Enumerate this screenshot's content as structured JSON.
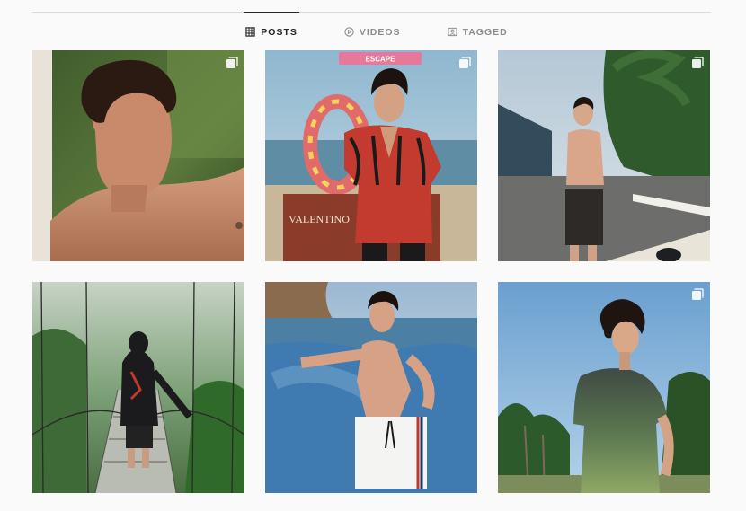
{
  "tabs": [
    {
      "label": "POSTS",
      "icon": "grid-icon",
      "active": true
    },
    {
      "label": "VIDEOS",
      "icon": "play-circle-icon",
      "active": false
    },
    {
      "label": "TAGGED",
      "icon": "tag-portrait-icon",
      "active": false
    }
  ],
  "posts": [
    {
      "icon": "carousel-icon",
      "desc": "close-up portrait, curly hair, green foliage"
    },
    {
      "icon": "carousel-icon",
      "desc": "patterned shirt on beach with float ring",
      "sign_text": "ESCAPE",
      "box_text": "VALENTINO"
    },
    {
      "icon": "carousel-icon",
      "desc": "standing on pavement, palm trees"
    },
    {
      "icon": "",
      "desc": "hooded figure on suspension bridge in forest"
    },
    {
      "icon": "",
      "desc": "leaning on blue painted wall by the sea"
    },
    {
      "icon": "carousel-icon",
      "desc": "curly hair, green gradient t-shirt, sky and trees"
    }
  ],
  "colors": {
    "accent_text": "#262626",
    "muted_text": "#8e8e8e",
    "divider": "#dbdbdb",
    "background": "#fafafa"
  }
}
